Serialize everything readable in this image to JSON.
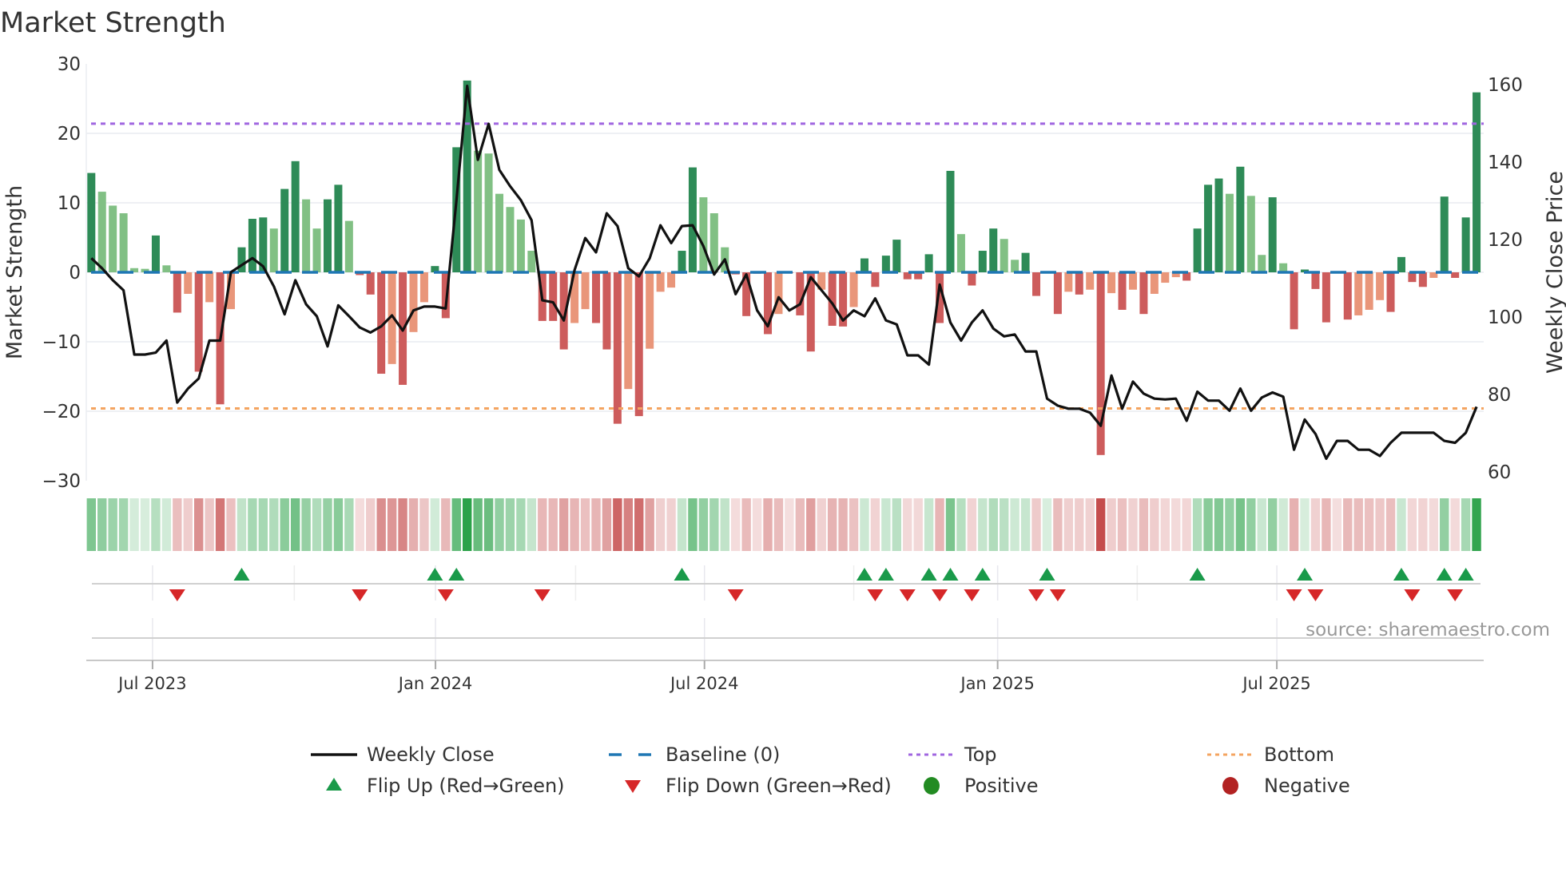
{
  "title": "Market Strength",
  "source": "source: sharemaestro.com",
  "colors": {
    "strong_green": "#2e8b57",
    "weak_green": "#81c084",
    "strong_red": "#cd5c5c",
    "weak_red": "#e9967a",
    "close_line": "#111111",
    "baseline": "#1f77b4",
    "top": "#a066e0",
    "bottom": "#f4a460",
    "flip_up": "#1a9a4a",
    "flip_down": "#d62728",
    "positive": "#228b22",
    "negative": "#b22222"
  },
  "chart_data": {
    "type": "bar",
    "title": "Market Strength",
    "ylabel": "Market Strength",
    "y2label": "Weekly Close Price",
    "ylim": [
      -30,
      30
    ],
    "y2lim": [
      57.7,
      165.4
    ],
    "yticks": [
      "30",
      "20",
      "10",
      "0",
      "−10",
      "−20",
      "−30"
    ],
    "ytick_values": [
      30,
      20,
      10,
      0,
      -10,
      -20,
      -30
    ],
    "y2ticks": [
      "160",
      "140",
      "120",
      "100",
      "80",
      "60"
    ],
    "y2tick_values": [
      160,
      140,
      120,
      100,
      80,
      60
    ],
    "x_unit": "week index",
    "xticks": [
      {
        "label": "Jul 2023",
        "at": 5.7
      },
      {
        "label": "Jan 2024",
        "at": 32.05
      },
      {
        "label": "Jul 2024",
        "at": 57.1
      },
      {
        "label": "Jan 2025",
        "at": 84.4
      },
      {
        "label": "Jul 2025",
        "at": 110.4
      }
    ],
    "minor_xticks": [
      18.9,
      45.1,
      71.0,
      97.4
    ],
    "grid": true,
    "top_level": 21.4,
    "bottom_level": -19.6,
    "baseline": 0,
    "strength": [
      14.3,
      11.6,
      9.6,
      8.5,
      0.6,
      0.5,
      5.3,
      1.0,
      -5.8,
      -3.1,
      -14.3,
      -4.3,
      -19.0,
      -5.3,
      3.6,
      7.7,
      7.9,
      6.3,
      12.0,
      16.0,
      10.5,
      6.3,
      10.5,
      12.6,
      7.4,
      -0.4,
      -3.2,
      -14.6,
      -13.2,
      -16.2,
      -8.6,
      -4.3,
      0.9,
      -6.6,
      18.0,
      27.6,
      17.5,
      17.1,
      11.3,
      9.4,
      7.6,
      3.1,
      -7.0,
      -7.0,
      -11.1,
      -7.3,
      -5.3,
      -7.3,
      -11.1,
      -21.8,
      -16.8,
      -20.7,
      -11.0,
      -2.8,
      -2.2,
      3.1,
      15.1,
      10.8,
      8.5,
      3.6,
      -0.3,
      -6.3,
      -0.2,
      -8.9,
      -6.0,
      -0.1,
      -6.2,
      -11.4,
      -2.5,
      -7.7,
      -7.8,
      -5.0,
      2.0,
      -2.1,
      2.4,
      4.7,
      -1.0,
      -1.0,
      2.6,
      -7.3,
      14.6,
      5.5,
      -1.9,
      3.1,
      6.3,
      4.8,
      1.8,
      2.8,
      -3.4,
      0.1,
      -6.0,
      -2.8,
      -3.2,
      -2.5,
      -26.3,
      -3.0,
      -5.4,
      -2.5,
      -6.0,
      -3.1,
      -1.5,
      -0.7,
      -1.2,
      6.3,
      12.6,
      13.5,
      11.3,
      15.2,
      11.0,
      2.5,
      10.8,
      1.3,
      -8.2,
      0.4,
      -2.4,
      -7.2,
      -0.1,
      -6.8,
      -6.2,
      -5.4,
      -4.0,
      -5.7,
      2.2,
      -1.4,
      -2.1,
      -0.8,
      10.9,
      -0.8,
      7.9,
      25.9
    ],
    "bar_shade": "GgggggGgRrRrRrGGGgGGggGGgRRRrRrrGRGGggggggRRRrrRRRrRrrrGGgggRRRRrRRRrRRrGRGGRRGRGgRGGggGRGRrRrRrRrRrrrRGGGgGggGgRGRRRRrrrRGRRrGRGG",
    "weekly_close": [
      115.2,
      112.6,
      109.5,
      106.9,
      90.3,
      90.3,
      90.8,
      93.9,
      77.9,
      81.5,
      84.1,
      93.9,
      93.9,
      111.6,
      113.4,
      115.2,
      113.1,
      107.9,
      100.7,
      109.5,
      103.3,
      100.2,
      92.4,
      103.0,
      100.2,
      97.3,
      96.0,
      97.6,
      100.4,
      96.5,
      101.7,
      102.7,
      102.7,
      102.2,
      130.2,
      159.7,
      140.6,
      149.9,
      138.0,
      133.8,
      130.2,
      125.0,
      104.3,
      103.8,
      99.1,
      112.1,
      120.4,
      116.7,
      126.8,
      123.5,
      112.6,
      110.5,
      115.2,
      123.7,
      119.1,
      123.5,
      123.7,
      118.3,
      111.0,
      114.9,
      105.9,
      111.0,
      101.7,
      97.6,
      105.1,
      101.7,
      103.3,
      110.3,
      106.9,
      103.5,
      99.1,
      101.7,
      100.2,
      104.8,
      99.1,
      98.1,
      90.1,
      90.1,
      87.7,
      108.4,
      98.6,
      93.9,
      98.6,
      101.7,
      97.0,
      95.0,
      95.5,
      91.1,
      91.1,
      78.9,
      77.1,
      76.3,
      76.3,
      75.3,
      71.9,
      84.9,
      76.3,
      83.3,
      80.2,
      78.9,
      78.7,
      78.9,
      73.2,
      80.7,
      78.4,
      78.4,
      75.8,
      81.5,
      75.8,
      79.2,
      80.5,
      79.4,
      65.7,
      73.5,
      69.8,
      63.4,
      68.0,
      68.0,
      65.7,
      65.7,
      64.1,
      67.5,
      70.1,
      70.1,
      70.1,
      70.1,
      68.0,
      67.5,
      70.1,
      76.8
    ],
    "flip_up_weeks": [
      15,
      33,
      35,
      56,
      73,
      75,
      79,
      81,
      84,
      90,
      104,
      114,
      123,
      127,
      129
    ],
    "flip_down_weeks": [
      9,
      26,
      34,
      43,
      61,
      74,
      77,
      80,
      83,
      89,
      91,
      113,
      115,
      124,
      128
    ],
    "legend_placement": "bottom-center"
  },
  "legend": {
    "weekly_close": "Weekly Close",
    "baseline": "Baseline (0)",
    "top": "Top",
    "bottom": "Bottom",
    "flip_up": "Flip Up (Red→Green)",
    "flip_down": "Flip Down (Green→Red)",
    "positive": "Positive",
    "negative": "Negative"
  }
}
